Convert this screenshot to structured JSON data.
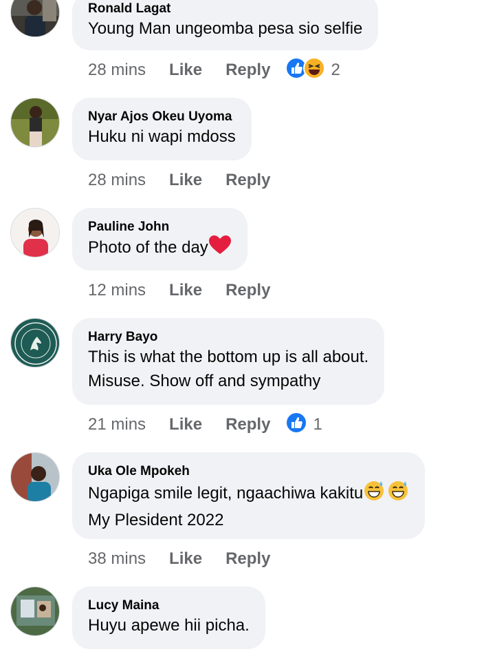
{
  "comments": [
    {
      "name": "Ronald Lagat",
      "lines": [
        "Young Man ungeomba pesa sio selfie"
      ],
      "time": "28 mins",
      "like": "Like",
      "reply": "Reply",
      "reaction_count": "2",
      "reactions": [
        "like-icon",
        "haha-icon"
      ]
    },
    {
      "name": "Nyar Ajos Okeu Uyoma",
      "lines": [
        "Huku ni wapi mdoss"
      ],
      "time": "28 mins",
      "like": "Like",
      "reply": "Reply"
    },
    {
      "name": "Pauline John",
      "lines": [
        "Photo of the day"
      ],
      "time": "12 mins",
      "like": "Like",
      "reply": "Reply",
      "inline_emoji": [
        "heart-emoji"
      ]
    },
    {
      "name": "Harry Bayo",
      "lines": [
        "This is what the bottom up is all about.",
        "Misuse. Show off and sympathy"
      ],
      "time": "21 mins",
      "like": "Like",
      "reply": "Reply",
      "reaction_count": "1",
      "reactions": [
        "like-icon"
      ]
    },
    {
      "name": "Uka Ole Mpokeh",
      "lines": [
        "Ngapiga smile legit, ngaachiwa kakitu",
        "My Plesident 2022"
      ],
      "time": "38 mins",
      "like": "Like",
      "reply": "Reply",
      "inline_emoji": [
        "sweat-smile-emoji",
        "sweat-smile-emoji"
      ]
    },
    {
      "name": "Lucy Maina",
      "lines": [
        "Huyu apewe hii picha."
      ],
      "time": "",
      "like": "",
      "reply": ""
    }
  ],
  "colors": {
    "bubble": "#f0f2f5",
    "meta": "#65676b",
    "like_blue": "#1877f2",
    "heart": "#e41e3f"
  }
}
